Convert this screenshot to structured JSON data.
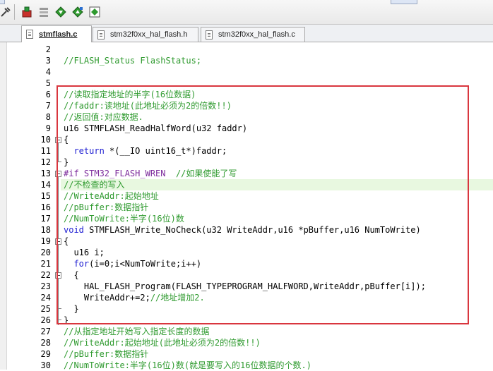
{
  "toolbar": {
    "icons": [
      "tools-icon",
      "bookmark-red-icon",
      "list-icon",
      "diamond-down-icon",
      "diamond-up-icon",
      "diamond-grid-icon"
    ]
  },
  "tabs": [
    {
      "label": "stmflash.c",
      "active": true
    },
    {
      "label": "stm32f0xx_hal_flash.h",
      "active": false
    },
    {
      "label": "stm32f0xx_hal_flash.c",
      "active": false
    }
  ],
  "code_lines": [
    {
      "n": "2",
      "text": ""
    },
    {
      "n": "3",
      "text": "//FLASH_Status FlashStatus;"
    },
    {
      "n": "4",
      "text": ""
    },
    {
      "n": "5",
      "text": ""
    },
    {
      "n": "6",
      "text": "//读取指定地址的半字(16位数据)"
    },
    {
      "n": "7",
      "text": "//faddr:读地址(此地址必须为2的倍数!!)"
    },
    {
      "n": "8",
      "text": "//返回值:对应数据."
    },
    {
      "n": "9",
      "text": "u16 STMFLASH_ReadHalfWord(u32 faddr)"
    },
    {
      "n": "10",
      "text": "{"
    },
    {
      "n": "11",
      "text": "  return *(__IO uint16_t*)faddr;"
    },
    {
      "n": "12",
      "text": "}"
    },
    {
      "n": "13",
      "text": "#if STM32_FLASH_WREN  //如果使能了写"
    },
    {
      "n": "14",
      "text": "//不检查的写入"
    },
    {
      "n": "15",
      "text": "//WriteAddr:起始地址"
    },
    {
      "n": "16",
      "text": "//pBuffer:数据指针"
    },
    {
      "n": "17",
      "text": "//NumToWrite:半字(16位)数"
    },
    {
      "n": "18",
      "text": "void STMFLASH_Write_NoCheck(u32 WriteAddr,u16 *pBuffer,u16 NumToWrite)"
    },
    {
      "n": "19",
      "text": "{"
    },
    {
      "n": "20",
      "text": "  u16 i;"
    },
    {
      "n": "21",
      "text": "  for(i=0;i<NumToWrite;i++)"
    },
    {
      "n": "22",
      "text": "  {"
    },
    {
      "n": "23",
      "text": "    HAL_FLASH_Program(FLASH_TYPEPROGRAM_HALFWORD,WriteAddr,pBuffer[i]);"
    },
    {
      "n": "24",
      "text": "    WriteAddr+=2;//地址增加2."
    },
    {
      "n": "25",
      "text": "  }"
    },
    {
      "n": "26",
      "text": "}"
    },
    {
      "n": "27",
      "text": "//从指定地址开始写入指定长度的数据"
    },
    {
      "n": "28",
      "text": "//WriteAddr:起始地址(此地址必须为2的倍数!!)"
    },
    {
      "n": "29",
      "text": "//pBuffer:数据指针"
    },
    {
      "n": "30",
      "text": "//NumToWrite:半字(16位)数(就是要写入的16位数据的个数.)"
    }
  ]
}
